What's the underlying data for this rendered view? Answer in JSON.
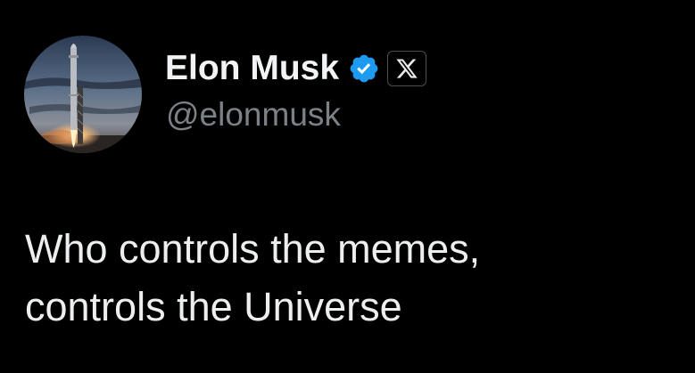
{
  "author": {
    "display_name": "Elon Musk",
    "handle": "@elonmusk",
    "verified": true,
    "affiliation_badge": "x-logo-icon",
    "avatar": "rocket-launch-avatar"
  },
  "tweet": {
    "lines": [
      "Who controls the memes,",
      "controls the Universe"
    ]
  },
  "colors": {
    "background": "#000000",
    "name": "#f2f3f4",
    "handle": "#7b8187",
    "text": "#eceeef",
    "verified_badge": "#1d9bf0",
    "badge_border": "#4a4d51"
  }
}
